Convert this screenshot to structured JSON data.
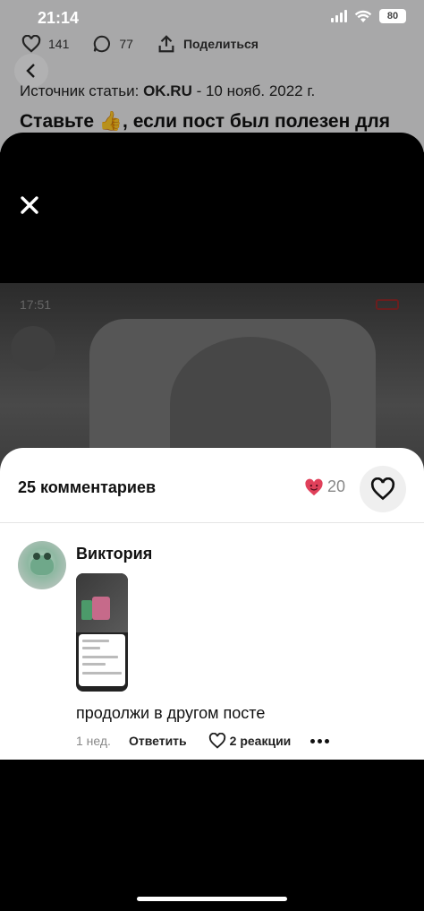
{
  "status_bar": {
    "time": "21:14",
    "battery": "80"
  },
  "article": {
    "likes": "141",
    "comments": "77",
    "share_label": "Поделиться",
    "source_prefix": "Источник статьи: ",
    "source_name": "OK.RU",
    "source_date": " - 10 нояб. 2022 г.",
    "headline": "Ставьте 👍, если пост был полезен для"
  },
  "viewer": {
    "inner_status_time": "17:51"
  },
  "comments_sheet": {
    "title": "25 комментариев",
    "reactions_count": "20",
    "comment": {
      "author": "Виктория",
      "text": "продолжи в другом посте",
      "time": "1 нед.",
      "reply_label": "Ответить",
      "reactions_label": "2 реакции"
    }
  },
  "colors": {
    "heart": "#e0405a",
    "overlay": "#000000",
    "sheet": "#ffffff"
  }
}
